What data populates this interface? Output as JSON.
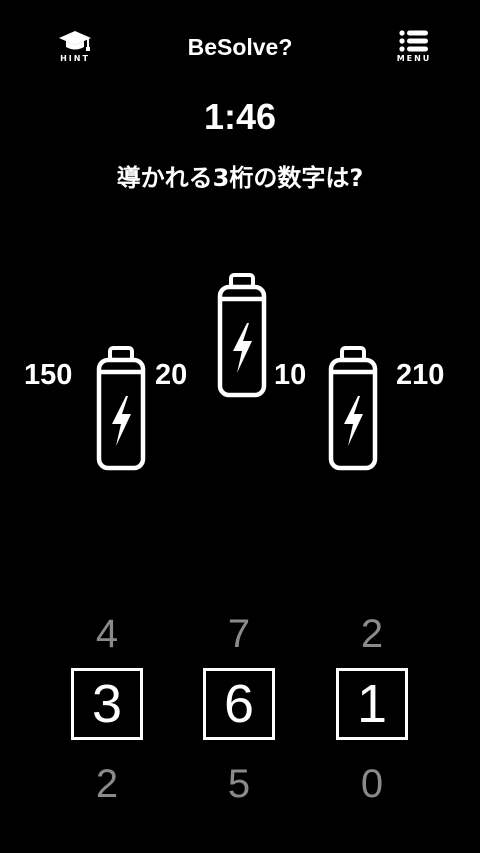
{
  "header": {
    "title": "BeSolve?",
    "hint_label": "HINT",
    "menu_label": "MENU"
  },
  "timer": "1:46",
  "question": "導かれる3桁の数字は?",
  "puzzle": {
    "clues": [
      "150",
      "20",
      "10",
      "210"
    ],
    "batteries": [
      "battery",
      "battery",
      "battery"
    ]
  },
  "answer": {
    "above": [
      "4",
      "7",
      "2"
    ],
    "current": [
      "3",
      "6",
      "1"
    ],
    "below": [
      "2",
      "5",
      "0"
    ]
  }
}
